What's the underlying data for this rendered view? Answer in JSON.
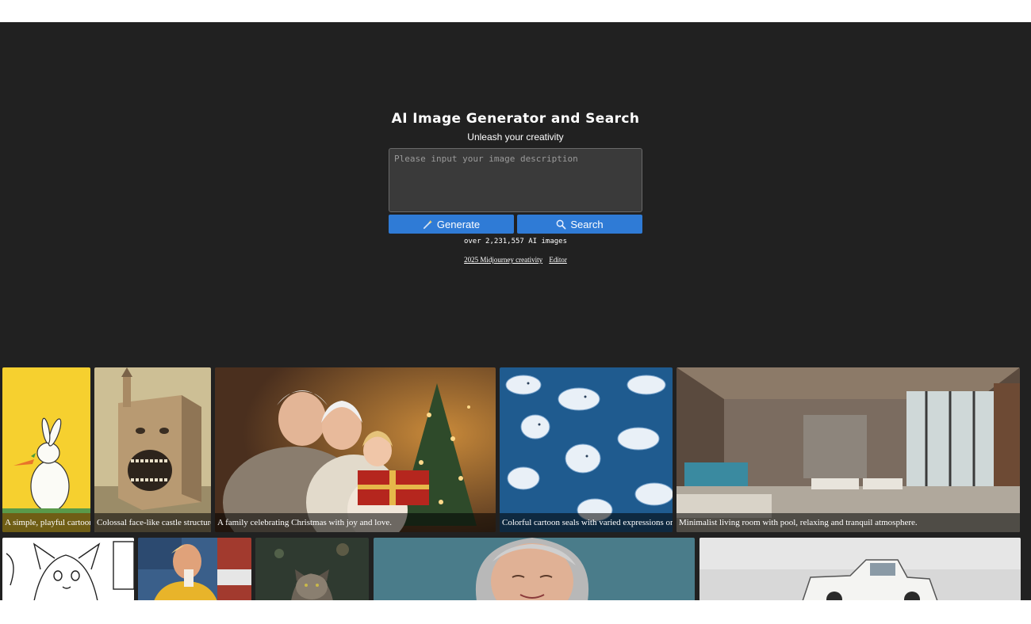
{
  "hero": {
    "title": "AI Image Generator and Search",
    "subtitle": "Unleash your creativity"
  },
  "prompt": {
    "placeholder": "Please input your image description",
    "value": ""
  },
  "buttons": {
    "generate_label": "Generate",
    "search_label": "Search"
  },
  "stats": {
    "count_text": "over 2,231,557 AI images"
  },
  "footer_links": [
    {
      "label": "2025 Midjourney creativity"
    },
    {
      "label": "Editor"
    }
  ],
  "gallery": {
    "row1": [
      {
        "caption": "A simple, playful cartoon",
        "icon": "bunny-image"
      },
      {
        "caption": "Colossal face-like castle structure",
        "icon": "castle-image"
      },
      {
        "caption": "A family celebrating Christmas with joy and love.",
        "icon": "family-image"
      },
      {
        "caption": "Colorful cartoon seals with varied expressions on",
        "icon": "seals-image"
      },
      {
        "caption": "Minimalist living room with pool, relaxing and tranquil atmosphere.",
        "icon": "living-room-image"
      }
    ],
    "row2": [
      {
        "caption": "",
        "icon": "dog-sketch-image"
      },
      {
        "caption": "",
        "icon": "man-drink-image"
      },
      {
        "caption": "",
        "icon": "cat-image"
      },
      {
        "caption": "",
        "icon": "woman-portrait-image"
      },
      {
        "caption": "",
        "icon": "truck-image"
      }
    ]
  },
  "colors": {
    "background": "#212121",
    "accent": "#2f7bd6",
    "text": "#ffffff"
  }
}
